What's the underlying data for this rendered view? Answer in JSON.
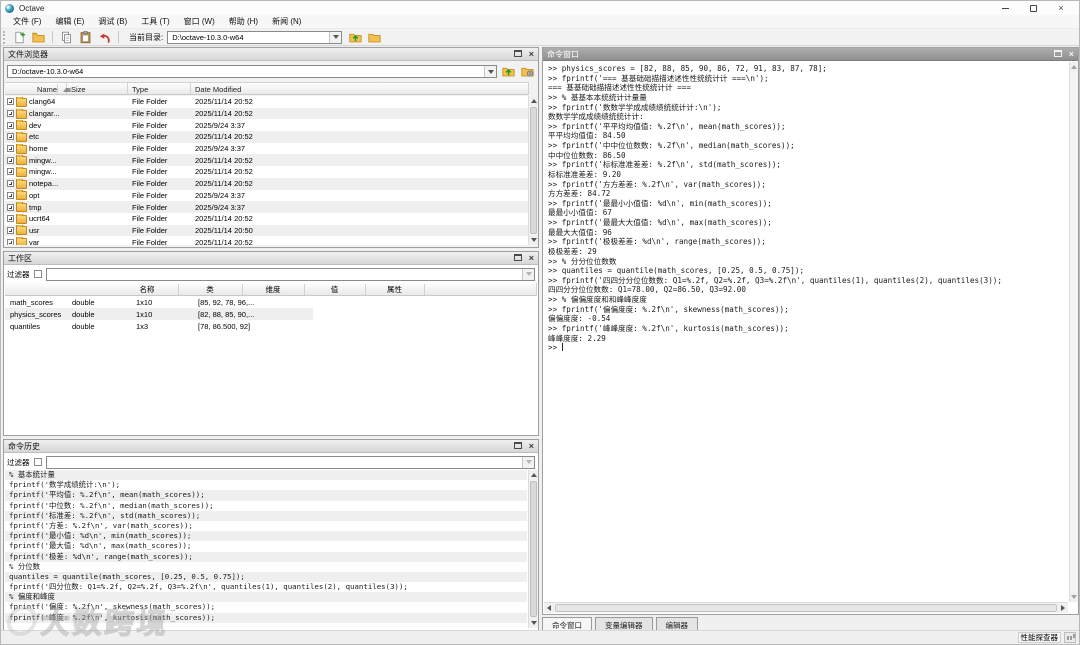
{
  "window": {
    "title": "Octave"
  },
  "menu": {
    "items": [
      "文件 (F)",
      "编辑 (E)",
      "调试 (B)",
      "工具 (T)",
      "窗口 (W)",
      "帮助 (H)",
      "新闻 (N)"
    ]
  },
  "toolbar": {
    "current_dir_label": "当前目录:",
    "current_dir_value": "D:\\octave-10.3.0-w64",
    "icons": [
      "new-script-icon",
      "open-file-icon",
      "copy-icon",
      "paste-icon",
      "undo-icon",
      "folder-up-icon",
      "browse-directory-icon"
    ]
  },
  "file_browser": {
    "title": "文件浏览器",
    "path": "D:/octave-10.3.0-w64",
    "headers": [
      "Name",
      "Size",
      "Type",
      "Date Modified"
    ],
    "rows": [
      {
        "name": "clang64",
        "size": "",
        "type": "File Folder",
        "date": "2025/11/14 20:52"
      },
      {
        "name": "clangar...",
        "size": "",
        "type": "File Folder",
        "date": "2025/11/14 20:52"
      },
      {
        "name": "dev",
        "size": "",
        "type": "File Folder",
        "date": "2025/9/24 3:37"
      },
      {
        "name": "etc",
        "size": "",
        "type": "File Folder",
        "date": "2025/11/14 20:52"
      },
      {
        "name": "home",
        "size": "",
        "type": "File Folder",
        "date": "2025/9/24 3:37"
      },
      {
        "name": "mingw...",
        "size": "",
        "type": "File Folder",
        "date": "2025/11/14 20:52"
      },
      {
        "name": "mingw...",
        "size": "",
        "type": "File Folder",
        "date": "2025/11/14 20:52"
      },
      {
        "name": "notepa...",
        "size": "",
        "type": "File Folder",
        "date": "2025/11/14 20:52"
      },
      {
        "name": "opt",
        "size": "",
        "type": "File Folder",
        "date": "2025/9/24 3:37"
      },
      {
        "name": "tmp",
        "size": "",
        "type": "File Folder",
        "date": "2025/9/24 3:37"
      },
      {
        "name": "ucrt64",
        "size": "",
        "type": "File Folder",
        "date": "2025/11/14 20:52"
      },
      {
        "name": "usr",
        "size": "",
        "type": "File Folder",
        "date": "2025/11/14 20:50"
      },
      {
        "name": "var",
        "size": "",
        "type": "File Folder",
        "date": "2025/11/14 20:52"
      }
    ]
  },
  "workspace": {
    "title": "工作区",
    "filter_label": "过滤器",
    "headers": [
      "名称",
      "类",
      "维度",
      "值",
      "属性"
    ],
    "rows": [
      {
        "name": "math_scores",
        "class": "double",
        "dims": "1x10",
        "value": "[85, 92, 78, 96,...",
        "attr": ""
      },
      {
        "name": "physics_scores",
        "class": "double",
        "dims": "1x10",
        "value": "[82, 88, 85, 90,...",
        "attr": ""
      },
      {
        "name": "quantiles",
        "class": "double",
        "dims": "1x3",
        "value": "[78, 86.500, 92]",
        "attr": ""
      }
    ]
  },
  "history": {
    "title": "命令历史",
    "filter_label": "过滤器",
    "lines": [
      "% 基本统计量",
      "fprintf('数学成绩统计:\\n');",
      "fprintf('平均值: %.2f\\n', mean(math_scores));",
      "fprintf('中位数: %.2f\\n', median(math_scores));",
      "fprintf('标准差: %.2f\\n', std(math_scores));",
      "fprintf('方差: %.2f\\n', var(math_scores));",
      "fprintf('最小值: %d\\n', min(math_scores));",
      "fprintf('最大值: %d\\n', max(math_scores));",
      "fprintf('极差: %d\\n', range(math_scores));",
      "% 分位数",
      "quantiles = quantile(math_scores, [0.25, 0.5, 0.75]);",
      "fprintf('四分位数: Q1=%.2f, Q2=%.2f, Q3=%.2f\\n', quantiles(1), quantiles(2), quantiles(3));",
      "% 偏度和峰度",
      "fprintf('偏度: %.2f\\n', skewness(math_scores));",
      "fprintf('峰度: %.2f\\n', kurtosis(math_scores));"
    ]
  },
  "command_window": {
    "title": "命令窗口",
    "prompt": ">> ",
    "lines": [
      ">> physics_scores = [82, 88, 85, 90, 86, 72, 91, 83, 87, 78];",
      ">> fprintf('=== 基基础础描描述述性性统统计计 ===\\n');",
      "=== 基基础础描描述述性性统统计计 ===",
      ">> % 基基本本统统计计量量",
      ">> fprintf('数数学学成成绩绩统统计计:\\n');",
      "数数学学成成绩绩统统计计:",
      ">> fprintf('平平均均值值: %.2f\\n', mean(math_scores));",
      "平平均均值值: 84.50",
      ">> fprintf('中中位位数数: %.2f\\n', median(math_scores));",
      "中中位位数数: 86.50",
      ">> fprintf('标标准准差差: %.2f\\n', std(math_scores));",
      "标标准准差差: 9.20",
      ">> fprintf('方方差差: %.2f\\n', var(math_scores));",
      "方方差差: 84.72",
      ">> fprintf('最最小小值值: %d\\n', min(math_scores));",
      "最最小小值值: 67",
      ">> fprintf('最最大大值值: %d\\n', max(math_scores));",
      "最最大大值值: 96",
      ">> fprintf('极极差差: %d\\n', range(math_scores));",
      "极极差差: 29",
      ">> % 分分位位数数",
      ">> quantiles = quantile(math_scores, [0.25, 0.5, 0.75]);",
      ">> fprintf('四四分分位位数数: Q1=%.2f, Q2=%.2f, Q3=%.2f\\n', quantiles(1), quantiles(2), quantiles(3));",
      "四四分分位位数数: Q1=78.00, Q2=86.50, Q3=92.00",
      ">> % 偏偏度度和和峰峰度度",
      ">> fprintf('偏偏度度: %.2f\\n', skewness(math_scores));",
      "偏偏度度: -0.54",
      ">> fprintf('峰峰度度: %.2f\\n', kurtosis(math_scores));",
      "峰峰度度: 2.29"
    ]
  },
  "tabs": [
    {
      "label": "命令窗口",
      "name": "tab-command-window",
      "active": true
    },
    {
      "label": "变量编辑器",
      "name": "tab-variable-editor",
      "active": false
    },
    {
      "label": "编辑器",
      "name": "tab-editor",
      "active": false
    }
  ],
  "status_bar": {
    "profiler_label": "性能探查器"
  },
  "watermark": {
    "text": "大数跨境"
  },
  "colors": {
    "folder_yellow": "#f0c04a",
    "undo_red": "#c63a2f",
    "plus_green": "#28a228",
    "panel_title_dark": "#9c9c9c"
  }
}
